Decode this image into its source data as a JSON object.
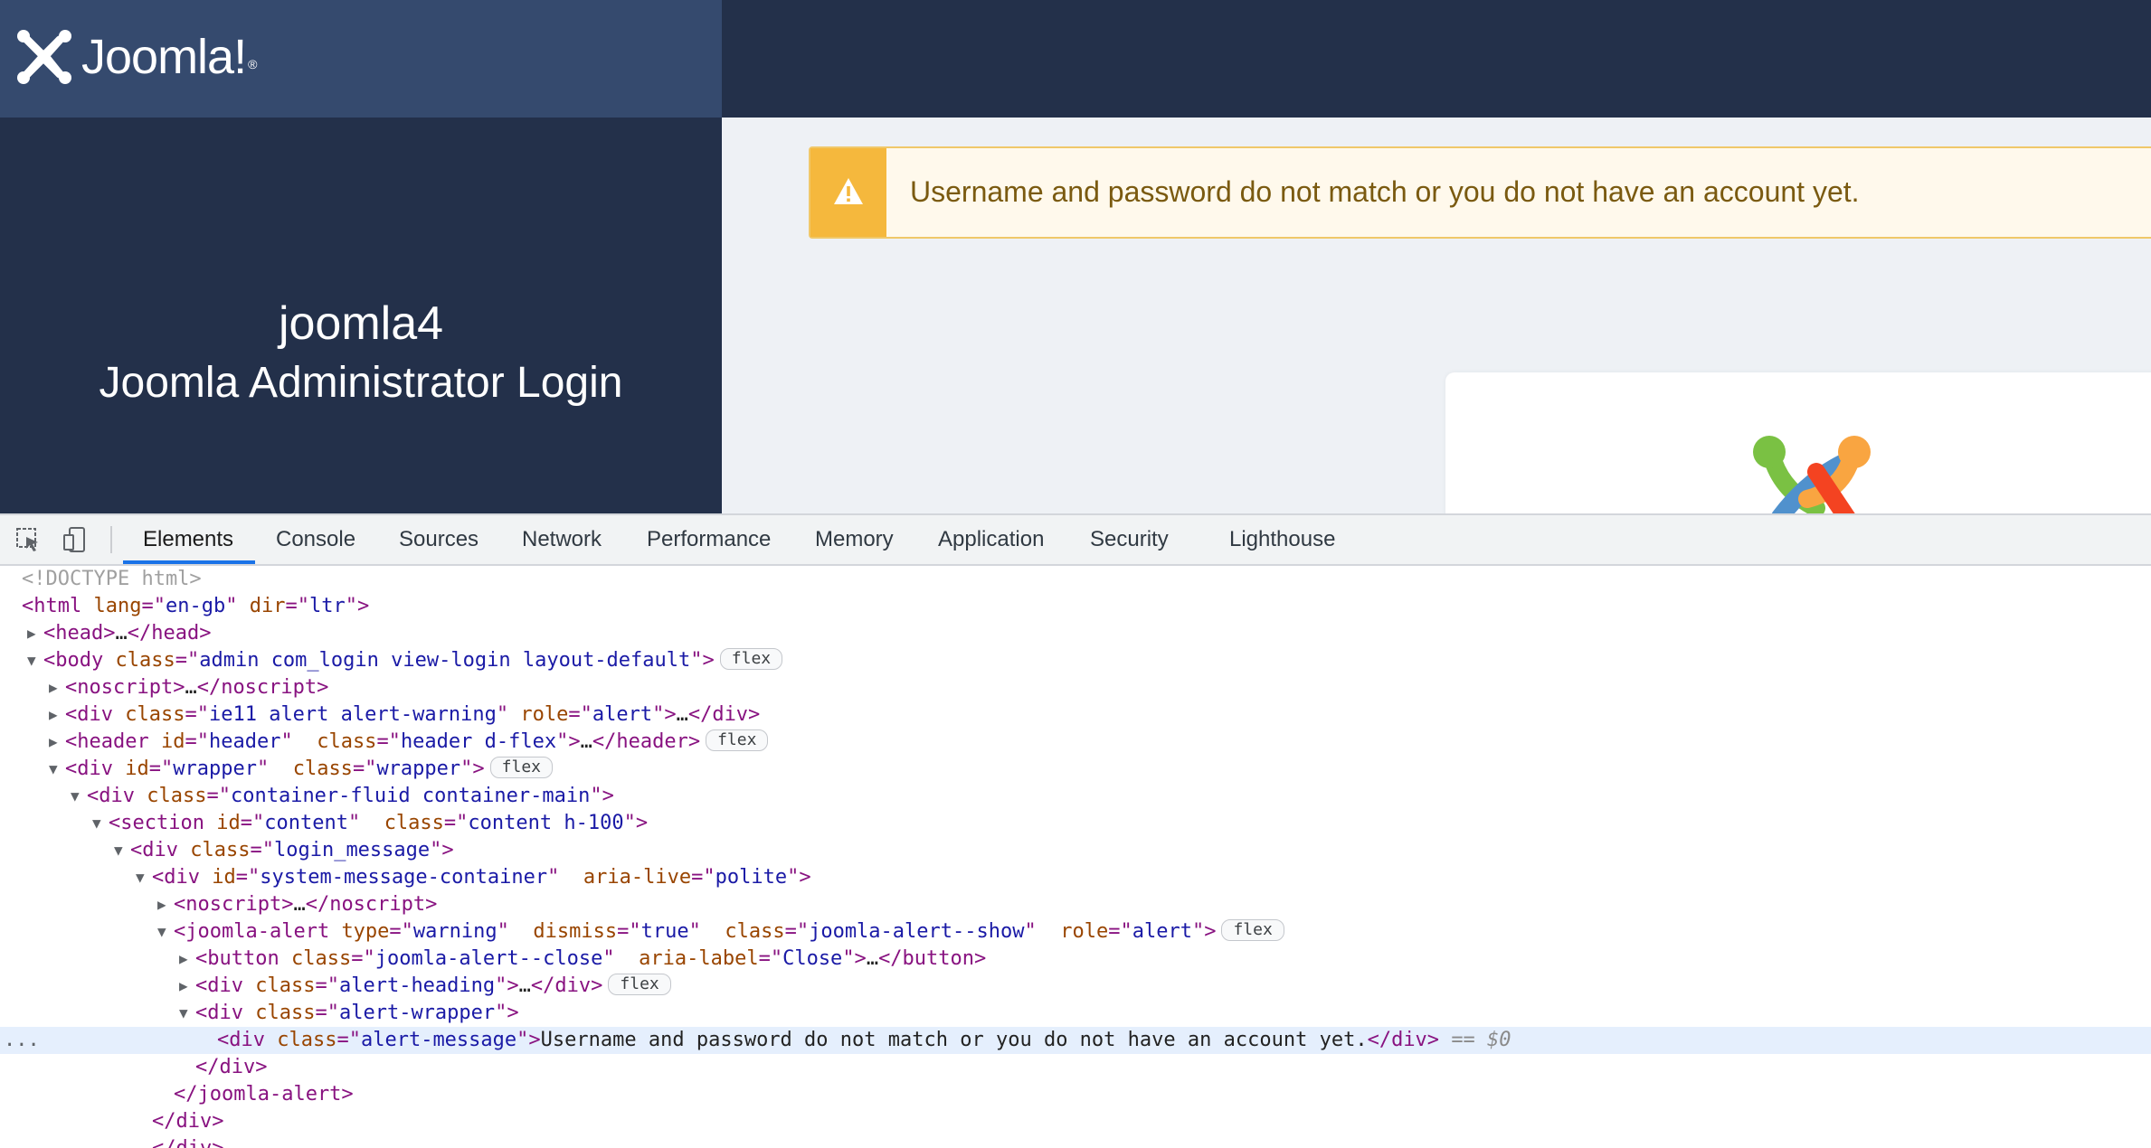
{
  "app": {
    "logo_text": "Joomla!",
    "site_name": "joomla4",
    "login_title": "Joomla Administrator Login"
  },
  "alert": {
    "icon": "warning-icon",
    "message": "Username and password do not match or you do not have an account yet."
  },
  "devtools": {
    "tabs": [
      {
        "label": "Elements",
        "active": true
      },
      {
        "label": "Console"
      },
      {
        "label": "Sources"
      },
      {
        "label": "Network"
      },
      {
        "label": "Performance"
      },
      {
        "label": "Memory"
      },
      {
        "label": "Application"
      },
      {
        "label": "Security"
      },
      {
        "label": "Lighthouse"
      }
    ],
    "selected_marker": "== $0",
    "ellipsis": "...",
    "flex_badge": "flex"
  },
  "colors": {
    "sidebar": "#23304a",
    "logo_bar": "#354a6e",
    "alert_bg": "#fff9ec",
    "alert_accent": "#f5b83d",
    "alert_text": "#7a5a10",
    "devtools_active_tab": "#1a73e8"
  }
}
